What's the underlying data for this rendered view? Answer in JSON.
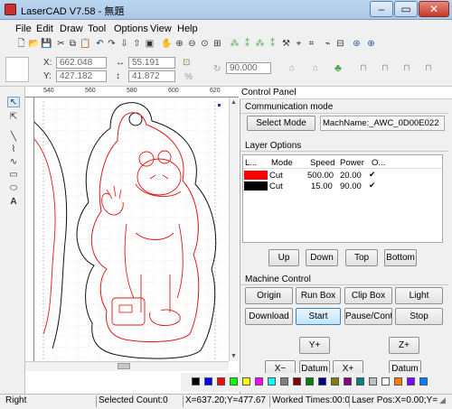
{
  "window": {
    "title": "LaserCAD V7.58 - 無題",
    "minimize": "–",
    "maximize": "▭",
    "close": "✕"
  },
  "menu": [
    "File",
    "Edit",
    "Draw",
    "Tool",
    "Options",
    "View",
    "Help"
  ],
  "toolbar2": {
    "x_label": "X:",
    "x_value": "662.048",
    "y_label": "Y:",
    "y_value": "427.182",
    "w_value": "55.191",
    "h_value": "41.872",
    "percent": "%",
    "angle_value": "90.000"
  },
  "ruler": {
    "top_marks": [
      "540",
      "560",
      "580",
      "600",
      "620"
    ]
  },
  "panel": {
    "title": "Control Panel",
    "comm_label": "Communication mode",
    "select_mode": "Select Mode",
    "mach_name": "MachName:_AWC_0D00E022",
    "layer_label": "Layer Options",
    "columns": [
      "L...",
      "Mode",
      "Speed",
      "Power",
      "O..."
    ],
    "layers": [
      {
        "color": "#ff0000",
        "mode": "Cut",
        "speed": "500.00",
        "power": "20.00",
        "output": "✔"
      },
      {
        "color": "#000000",
        "mode": "Cut",
        "speed": "15.00",
        "power": "90.00",
        "output": "✔"
      }
    ],
    "layer_buttons": [
      "Up",
      "Down",
      "Top",
      "Bottom"
    ],
    "machine_label": "Machine Control",
    "machine_buttons_row1": [
      "Origin",
      "Run Box",
      "Clip Box",
      "Light"
    ],
    "machine_buttons_row2": [
      "Download",
      "Start",
      "Pause/Continue",
      "Stop"
    ],
    "jog": {
      "y_plus": "Y+",
      "z_plus": "Z+",
      "x_minus": "X−",
      "datum": "Datum",
      "x_plus": "X+",
      "datum2": "Datum"
    }
  },
  "palette": [
    "#000000",
    "#0000ff",
    "#ff0000",
    "#00ff00",
    "#ffff00",
    "#ff00ff",
    "#00ffff",
    "#808080",
    "#800000",
    "#008000",
    "#000080",
    "#808000",
    "#800080",
    "#008080",
    "#c0c0c0",
    "#ffffff",
    "#ff8000",
    "#8000ff",
    "#0080ff"
  ],
  "status": {
    "mode": "Right",
    "selected": "Selected Count:0",
    "coords": "X=637.20;Y=477.67",
    "worked": "Worked Times:00:00",
    "laser_pos": "Laser Pos:X=0.00;Y=0"
  }
}
